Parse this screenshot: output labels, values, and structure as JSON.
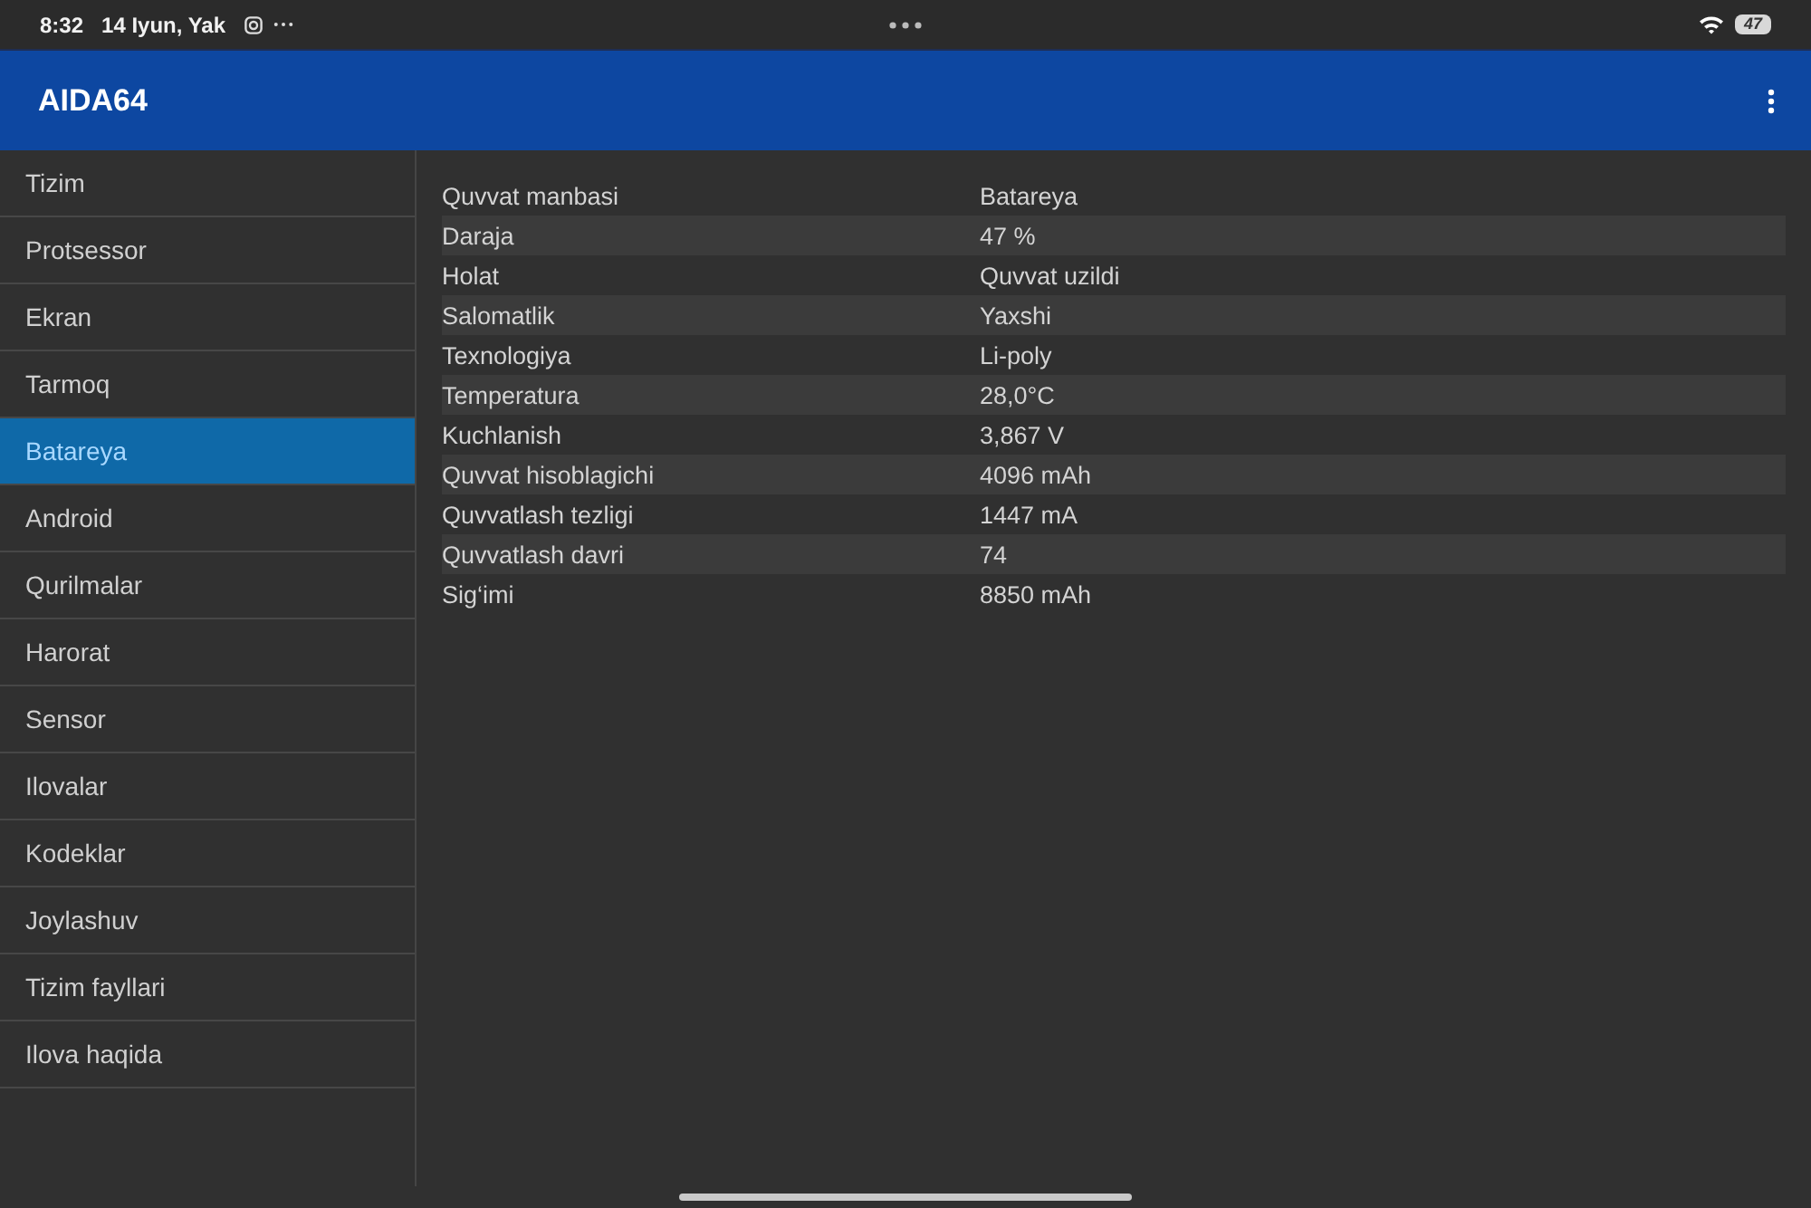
{
  "status_bar": {
    "time": "8:32",
    "date": "14 Iyun, Yak",
    "battery": "47"
  },
  "app_bar": {
    "title": "AIDA64"
  },
  "sidebar": {
    "items": [
      {
        "label": "Tizim",
        "selected": false
      },
      {
        "label": "Protsessor",
        "selected": false
      },
      {
        "label": "Ekran",
        "selected": false
      },
      {
        "label": "Tarmoq",
        "selected": false
      },
      {
        "label": "Batareya",
        "selected": true
      },
      {
        "label": "Android",
        "selected": false
      },
      {
        "label": "Qurilmalar",
        "selected": false
      },
      {
        "label": "Harorat",
        "selected": false
      },
      {
        "label": "Sensor",
        "selected": false
      },
      {
        "label": "Ilovalar",
        "selected": false
      },
      {
        "label": "Kodeklar",
        "selected": false
      },
      {
        "label": "Joylashuv",
        "selected": false
      },
      {
        "label": "Tizim fayllari",
        "selected": false
      },
      {
        "label": "Ilova haqida",
        "selected": false
      }
    ]
  },
  "table": {
    "rows": [
      {
        "label": "Quvvat manbasi",
        "value": "Batareya"
      },
      {
        "label": "Daraja",
        "value": "47 %"
      },
      {
        "label": "Holat",
        "value": "Quvvat uzildi"
      },
      {
        "label": "Salomatlik",
        "value": "Yaxshi"
      },
      {
        "label": "Texnologiya",
        "value": "Li-poly"
      },
      {
        "label": "Temperatura",
        "value": "28,0°C"
      },
      {
        "label": "Kuchlanish",
        "value": "3,867 V"
      },
      {
        "label": "Quvvat hisoblagichi",
        "value": "4096 mAh"
      },
      {
        "label": "Quvvatlash tezligi",
        "value": "1447 mA"
      },
      {
        "label": "Quvvatlash davri",
        "value": "74"
      },
      {
        "label": "Sig‘imi",
        "value": "8850 mAh"
      }
    ]
  }
}
